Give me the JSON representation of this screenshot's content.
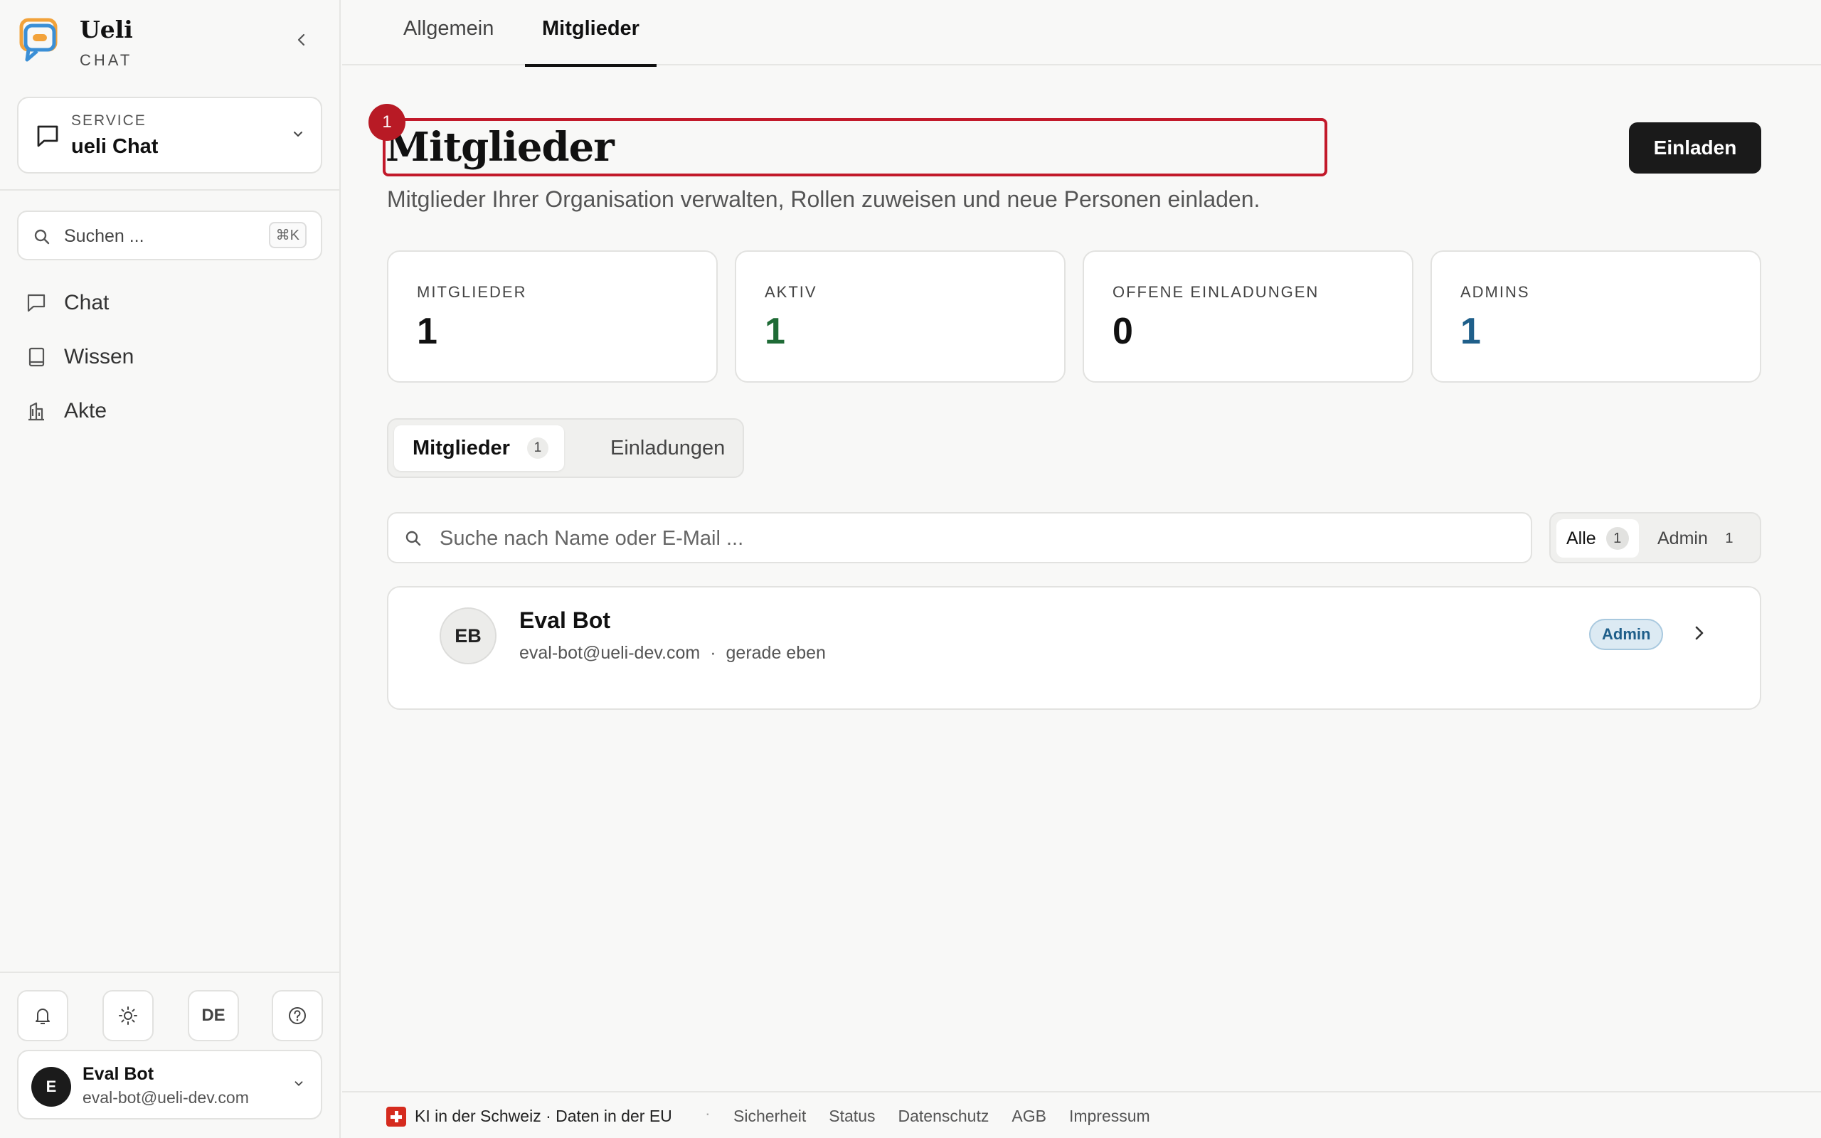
{
  "brand": {
    "name": "Ueli",
    "sub": "CHAT"
  },
  "service": {
    "label": "SERVICE",
    "value": "ueli Chat"
  },
  "search": {
    "placeholder": "Suchen ...",
    "shortcut": "⌘K"
  },
  "sidebar": {
    "items": [
      {
        "label": "Chat",
        "icon": "chat-icon"
      },
      {
        "label": "Wissen",
        "icon": "book-icon"
      },
      {
        "label": "Akte",
        "icon": "building-icon"
      }
    ],
    "language": "DE"
  },
  "user": {
    "initial": "E",
    "name": "Eval Bot",
    "email": "eval-bot@ueli-dev.com"
  },
  "tabs": [
    {
      "label": "Allgemein",
      "active": false
    },
    {
      "label": "Mitglieder",
      "active": true
    }
  ],
  "page": {
    "badge": "1",
    "title": "Mitglieder",
    "subtitle": "Mitglieder Ihrer Organisation verwalten, Rollen zuweisen und neue Personen einladen.",
    "invite_label": "Einladen"
  },
  "stats": [
    {
      "label": "MITGLIEDER",
      "value": "1",
      "color": "#111111"
    },
    {
      "label": "AKTIV",
      "value": "1",
      "color": "#1f6b36"
    },
    {
      "label": "OFFENE EINLADUNGEN",
      "value": "0",
      "color": "#111111"
    },
    {
      "label": "ADMINS",
      "value": "1",
      "color": "#1f5f8a"
    }
  ],
  "segment": {
    "members_label": "Mitglieder",
    "members_count": "1",
    "invites_label": "Einladungen"
  },
  "member_search": {
    "placeholder": "Suche nach Name oder E-Mail ..."
  },
  "filters": [
    {
      "label": "Alle",
      "count": "1",
      "active": true
    },
    {
      "label": "Admin",
      "count": "1",
      "active": false
    }
  ],
  "members": [
    {
      "initials": "EB",
      "name": "Eval Bot",
      "email": "eval-bot@ueli-dev.com",
      "last_seen": "gerade eben",
      "role": "Admin"
    }
  ],
  "footer": {
    "claim": "KI in der Schweiz · Daten in der EU",
    "separator": "·",
    "links": [
      "Sicherheit",
      "Status",
      "Datenschutz",
      "AGB",
      "Impressum"
    ]
  }
}
